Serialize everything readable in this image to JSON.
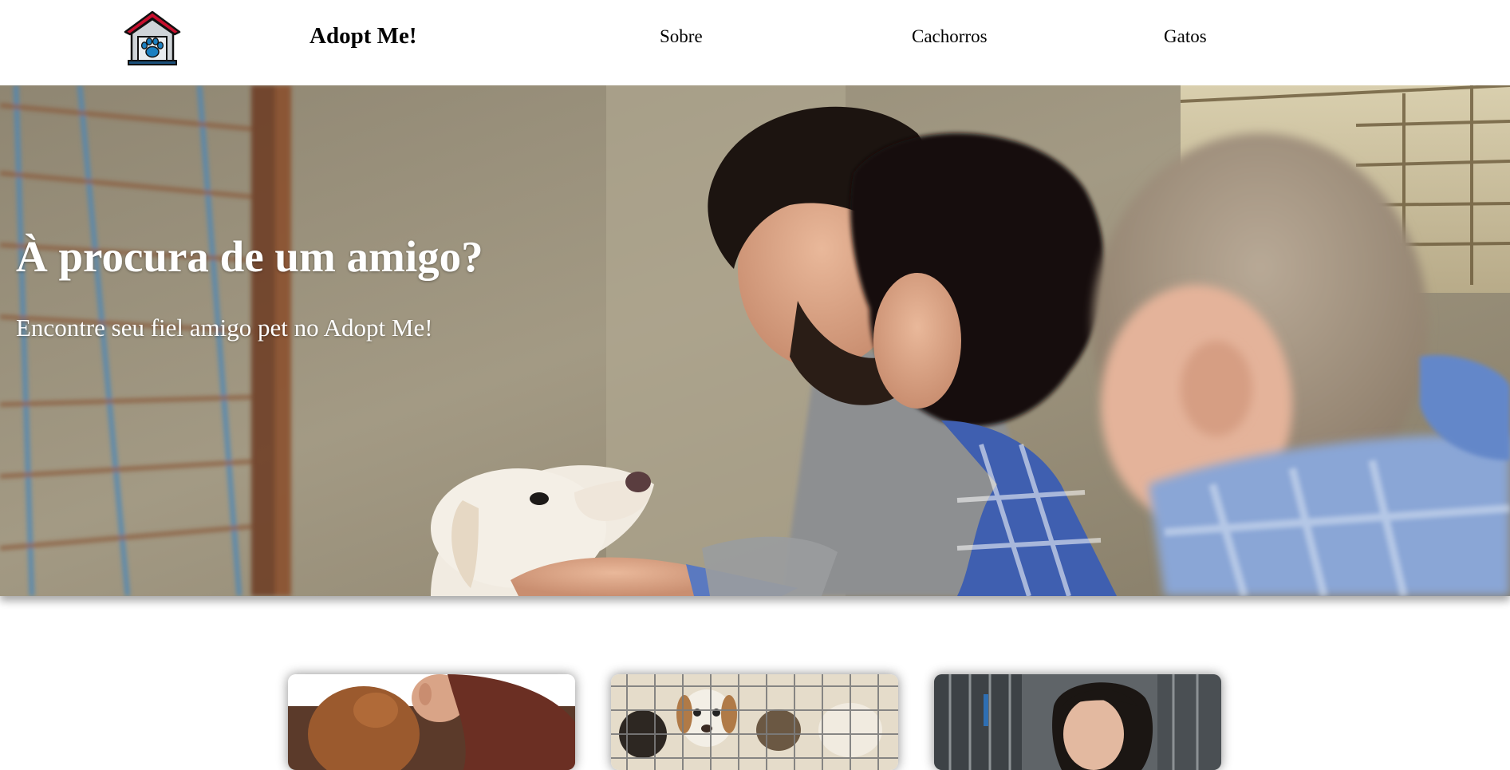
{
  "navbar": {
    "logo_icon": "pet-house-icon",
    "brand": "Adopt Me!",
    "links": [
      {
        "label": "Sobre"
      },
      {
        "label": "Cachorros"
      },
      {
        "label": "Gatos"
      }
    ]
  },
  "hero": {
    "title": "À procura de um amigo?",
    "subtitle": "Encontre seu fiel amigo pet no Adopt Me!",
    "image": "family-petting-shelter-dog-photo"
  },
  "cards": [
    {
      "image": "woman-hugging-puppy-photo"
    },
    {
      "image": "puppies-in-cage-photo"
    },
    {
      "image": "woman-at-kennel-photo"
    }
  ],
  "colors": {
    "logo_roof": "#c8102e",
    "logo_paw": "#1a7fc1",
    "text": "#000000",
    "hero_text": "#ffffff"
  }
}
